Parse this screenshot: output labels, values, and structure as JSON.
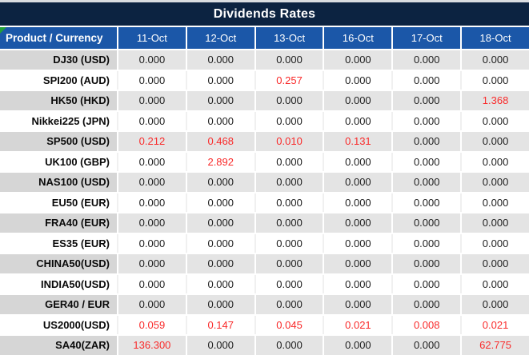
{
  "title": "Dividends Rates",
  "columns": [
    "Product / Currency",
    "11-Oct",
    "12-Oct",
    "13-Oct",
    "16-Oct",
    "17-Oct",
    "18-Oct"
  ],
  "rows": [
    {
      "label": "DJ30 (USD)",
      "values": [
        "0.000",
        "0.000",
        "0.000",
        "0.000",
        "0.000",
        "0.000"
      ],
      "red": []
    },
    {
      "label": "SPI200 (AUD)",
      "values": [
        "0.000",
        "0.000",
        "0.257",
        "0.000",
        "0.000",
        "0.000"
      ],
      "red": [
        2
      ]
    },
    {
      "label": "HK50 (HKD)",
      "values": [
        "0.000",
        "0.000",
        "0.000",
        "0.000",
        "0.000",
        "1.368"
      ],
      "red": [
        5
      ]
    },
    {
      "label": "Nikkei225 (JPN)",
      "values": [
        "0.000",
        "0.000",
        "0.000",
        "0.000",
        "0.000",
        "0.000"
      ],
      "red": []
    },
    {
      "label": "SP500 (USD)",
      "values": [
        "0.212",
        "0.468",
        "0.010",
        "0.131",
        "0.000",
        "0.000"
      ],
      "red": [
        0,
        1,
        2,
        3
      ]
    },
    {
      "label": "UK100 (GBP)",
      "values": [
        "0.000",
        "2.892",
        "0.000",
        "0.000",
        "0.000",
        "0.000"
      ],
      "red": [
        1
      ]
    },
    {
      "label": "NAS100 (USD)",
      "values": [
        "0.000",
        "0.000",
        "0.000",
        "0.000",
        "0.000",
        "0.000"
      ],
      "red": []
    },
    {
      "label": "EU50 (EUR)",
      "values": [
        "0.000",
        "0.000",
        "0.000",
        "0.000",
        "0.000",
        "0.000"
      ],
      "red": []
    },
    {
      "label": "FRA40 (EUR)",
      "values": [
        "0.000",
        "0.000",
        "0.000",
        "0.000",
        "0.000",
        "0.000"
      ],
      "red": []
    },
    {
      "label": "ES35 (EUR)",
      "values": [
        "0.000",
        "0.000",
        "0.000",
        "0.000",
        "0.000",
        "0.000"
      ],
      "red": []
    },
    {
      "label": "CHINA50(USD)",
      "values": [
        "0.000",
        "0.000",
        "0.000",
        "0.000",
        "0.000",
        "0.000"
      ],
      "red": []
    },
    {
      "label": "INDIA50(USD)",
      "values": [
        "0.000",
        "0.000",
        "0.000",
        "0.000",
        "0.000",
        "0.000"
      ],
      "red": []
    },
    {
      "label": "GER40 / EUR",
      "values": [
        "0.000",
        "0.000",
        "0.000",
        "0.000",
        "0.000",
        "0.000"
      ],
      "red": []
    },
    {
      "label": "US2000(USD)",
      "values": [
        "0.059",
        "0.147",
        "0.045",
        "0.021",
        "0.008",
        "0.021"
      ],
      "red": [
        0,
        1,
        2,
        3,
        4,
        5
      ]
    },
    {
      "label": "SA40(ZAR)",
      "values": [
        "136.300",
        "0.000",
        "0.000",
        "0.000",
        "0.000",
        "62.775"
      ],
      "red": [
        0,
        5
      ]
    }
  ],
  "colors": {
    "title_bg": "#0C2341",
    "header_bg": "#1B57A8",
    "stripe_label_bg": "#D6D6D6",
    "stripe_value_bg": "#E4E4E4",
    "red_value": "#F92B2B",
    "green_flag": "#21A038",
    "top_strip": "#DADDE1",
    "value_text": "#1E1E1E"
  }
}
